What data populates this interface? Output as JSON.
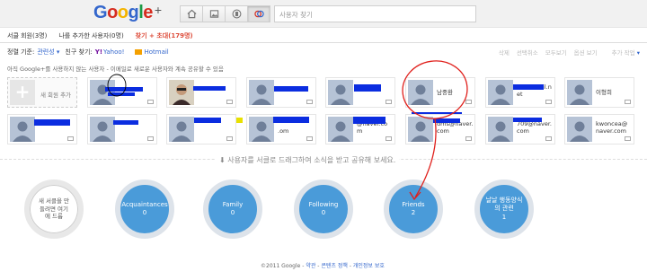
{
  "header": {
    "logo": {
      "G": "G",
      "o1": "o",
      "o2": "o",
      "g": "g",
      "l": "l",
      "e": "e",
      "plus": "+"
    },
    "search_placeholder": "사용자 찾기",
    "nav_icons": [
      "home-icon",
      "photos-icon",
      "profile-icon",
      "circles-icon"
    ]
  },
  "subtabs": {
    "circled": "서클 회원(3명)",
    "added_me": "나를 추가한 사용자(0명)",
    "find_invite": "찾기 + 초대(179명)"
  },
  "filter": {
    "sort_label": "정렬 기준:",
    "sort_value": "관련성",
    "find_friends_label": "친구 찾기:",
    "yahoo": "Yahoo!",
    "hotmail": "Hotmail"
  },
  "right_menu": {
    "delete": "삭제",
    "select_all": "선택취소",
    "more_view": "모두보기",
    "options": "옵션 보기",
    "add_action": "추가 작업"
  },
  "note": "아직 Google+를 사용하지 않는 사용자 - 이메일로 새로운 사용자와 계속 공유할 수 있음",
  "new_member": "새 회원 추가",
  "people": [
    {
      "name": ""
    },
    {
      "name": ""
    },
    {
      "name": ""
    },
    {
      "name": ""
    },
    {
      "name": "남중환"
    },
    {
      "name": "@hanmail.n\net"
    },
    {
      "name": "이형희"
    },
    {
      "name": ""
    },
    {
      "name": ""
    },
    {
      "name": ""
    },
    {
      "name": "\n.om"
    },
    {
      "name": "@naver.co\nm"
    },
    {
      "name": "dms@naver.\ncom"
    },
    {
      "name": "709@naver.\ncom"
    },
    {
      "name": "kwoncea@\nnaver.com"
    }
  ],
  "drag_hint": "사용자를 서클로 드래그하여 소식을 받고 공유해 보세요.",
  "new_circle": "새 서클을 만\n들려면 여기\n에 드롭",
  "circles": [
    {
      "name": "Acquaintances",
      "count": "0"
    },
    {
      "name": "Family",
      "count": "0"
    },
    {
      "name": "Following",
      "count": "0"
    },
    {
      "name": "Friends",
      "count": "2"
    },
    {
      "name": "날날 행동양식\n의 관련",
      "count": "1"
    }
  ],
  "footer": {
    "copyright": "©2011 Google - ",
    "terms": "약관",
    "content_policy": "콘텐츠 정책",
    "privacy": "개인정보 보호"
  },
  "colors": {
    "accent": "#3366cc",
    "circle_blue": "#4a9bd9",
    "invite_red": "#dd4b39",
    "annotation_red": "#e0201c",
    "redact_blue": "#0b2de0"
  }
}
